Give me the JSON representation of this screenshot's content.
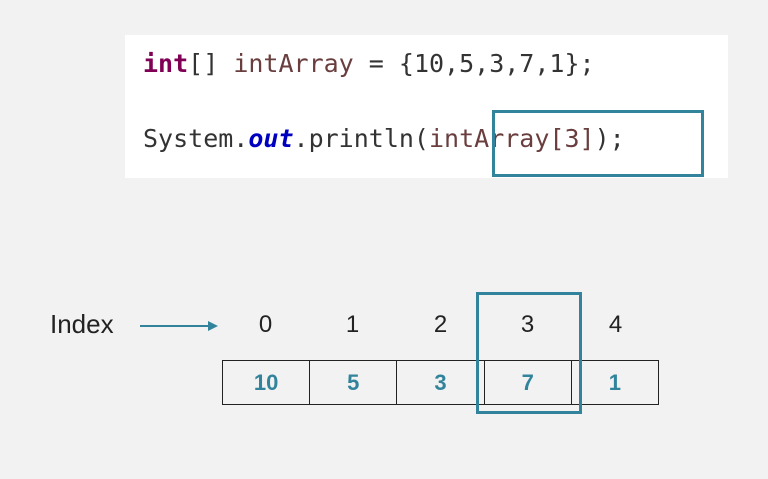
{
  "code": {
    "line1": {
      "keyword": "int",
      "brackets": "[] ",
      "identifier": "intArray",
      "rest": " = {10,5,3,7,1};"
    },
    "line2": {
      "prefix": "System.",
      "field": "out",
      "call": ".println(",
      "highlighted": "intArray[3]",
      "suffix": ");"
    }
  },
  "index_label": "Index",
  "indices": [
    "0",
    "1",
    "2",
    "3",
    "4"
  ],
  "values": [
    "10",
    "5",
    "3",
    "7",
    "1"
  ],
  "highlighted_index": 3,
  "colors": {
    "accent": "#31849b",
    "keyword": "#7f0055",
    "identifier": "#6a3e3e",
    "field": "#0000c0"
  }
}
